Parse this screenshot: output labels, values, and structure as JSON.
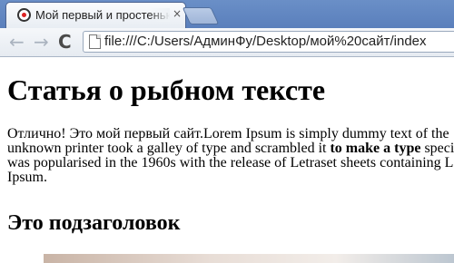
{
  "browser": {
    "tab_title": "Мой первый и простеньки",
    "tab_close": "×",
    "address_url": "file:///C:/Users/АдминФу/Desktop/мой%20сайт/index",
    "icons": {
      "favicon": "chrome-favicon-icon",
      "back": "back-arrow-icon",
      "forward": "forward-arrow-icon",
      "reload": "reload-icon",
      "page": "page-document-icon"
    },
    "glyphs": {
      "back": "←",
      "forward": "→",
      "reload": "C"
    }
  },
  "page": {
    "heading": "Статья о рыбном тексте",
    "paragraph": {
      "line1": "Отлично! Это мой первый сайт.Lorem Ipsum is simply dummy text of the",
      "line2_before": "unknown printer took a galley of type and scrambled it ",
      "line2_bold": "to make a type",
      "line2_after": " speci",
      "line3": "was popularised in the 1960s with the release of Letraset sheets containing L",
      "line4": "Ipsum."
    },
    "subheading": "Это подзаголовок"
  }
}
